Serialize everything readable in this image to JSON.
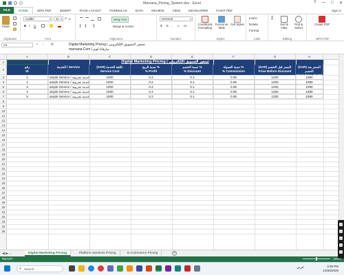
{
  "window": {
    "title": "Marvana_Pricing_System.xlsx - Excel",
    "controls": [
      "?",
      "—",
      "□",
      "✕"
    ]
  },
  "ribbon_tabs": [
    "FILE",
    "HOME",
    "WPS PDF",
    "INSERT",
    "PAGE LAYOUT",
    "FORMULAS",
    "DATA",
    "REVIEW",
    "VIEW",
    "DEVELOPER",
    "FOXIT PDF"
  ],
  "user": "Sign in",
  "ribbon": {
    "clipboard": {
      "paste": "Paste",
      "label": "Clipboard"
    },
    "font": {
      "name": "Calibri",
      "size": "11",
      "label": "Font",
      "bold": "B",
      "italic": "I",
      "underline": "U"
    },
    "alignment": {
      "wrap_text": "Wrap Text",
      "merge_center": "Merge & Center",
      "label": "Alignment"
    },
    "number": {
      "format": "General",
      "label": "Number",
      "currency": "$",
      "percent": "%",
      "comma": ","
    },
    "styles": {
      "conditional": "Conditional Formatting",
      "format_table": "Format as Table",
      "cell_styles": "Cell Styles",
      "label": "Styles"
    },
    "cells": {
      "insert": "Insert",
      "delete": "Delete",
      "format": "Format",
      "label": "Cells"
    },
    "editing": {
      "sum": "Σ",
      "sort_filter": "Sort & Filter",
      "find_select": "Find & Select",
      "label": "Editing"
    },
    "wps": {
      "create_pdf": "Create PDF",
      "label": "WPS PDF"
    }
  },
  "formula_bar": {
    "name_box": "A1",
    "fx": "fx",
    "content_line1": "Digital Marketing Pricing | تسعير التسويق الإلكتروني",
    "content_line2": "marvana.Com | مارفانا.كوم"
  },
  "columns": [
    "A",
    "B",
    "C",
    "D",
    "E",
    "F",
    "G",
    "H"
  ],
  "rows": [
    "1",
    "2",
    "3",
    "4",
    "5",
    "6",
    "7",
    "8",
    "9",
    "10",
    "11",
    "12",
    "13",
    "14",
    "15",
    "16",
    "17",
    "18",
    "19",
    "20",
    "21",
    "22",
    "23",
    "24",
    "25",
    "26",
    "27",
    "28",
    "29",
    "30",
    "31",
    "32",
    "33",
    "34",
    "35"
  ],
  "sheet": {
    "title": "Digital Marketing Pricing | تسعير التسويق الإلكتروني",
    "headers": [
      {
        "ar": "رقم",
        "en": "ID"
      },
      {
        "ar": "الخدمة / Service",
        "en": ""
      },
      {
        "ar": "(SAR) تكلفة الخدمة",
        "en": "Service Cost"
      },
      {
        "ar": "نسبة الربح %",
        "en": "% Profit"
      },
      {
        "ar": "نسبة الخصم %",
        "en": "% Discount"
      },
      {
        "ar": "نسبة العمولة %",
        "en": "% Commission"
      },
      {
        "ar": "(SAR) السعر قبل الخصم",
        "en": "Price Before Discount"
      },
      {
        "ar": "(SAR) السعر بعد الخصم",
        "en": "Final Price (SAR)"
      }
    ],
    "data": [
      [
        "1",
        "ample Service / خدمة تجريبية",
        "1000",
        "0.2",
        "0.1",
        "0.05",
        "1200",
        "1080"
      ],
      [
        "2",
        "ample Service / خدمة تجريبية",
        "1000",
        "0.2",
        "0.1",
        "0.05",
        "1200",
        "1080"
      ],
      [
        "3",
        "ample Service / خدمة تجريبية",
        "1000",
        "0.2",
        "0.1",
        "0.05",
        "1200",
        "1080"
      ],
      [
        "4",
        "ample Service / خدمة تجريبية",
        "1000",
        "0.2",
        "0.1",
        "0.05",
        "1200",
        "1080"
      ],
      [
        "5",
        "ample Service / خدمة تجريبية",
        "1000",
        "0.2",
        "0.1",
        "0.05",
        "1200",
        "1080"
      ]
    ]
  },
  "sheet_tabs": [
    "Digital Marketing Pricing",
    "Platform Services Pricing",
    "E-Commerce Pricing"
  ],
  "sheet_nav": "◀ ▶ ...",
  "status": {
    "ready": "READY",
    "zoom": "100%"
  },
  "taskbar": {
    "search": "Search",
    "lang": "عربي",
    "time": "3:36 PM",
    "date": "10/26/2025"
  },
  "colors": {
    "excel_green": "#217346",
    "header_navy": "#1f3f7a"
  }
}
